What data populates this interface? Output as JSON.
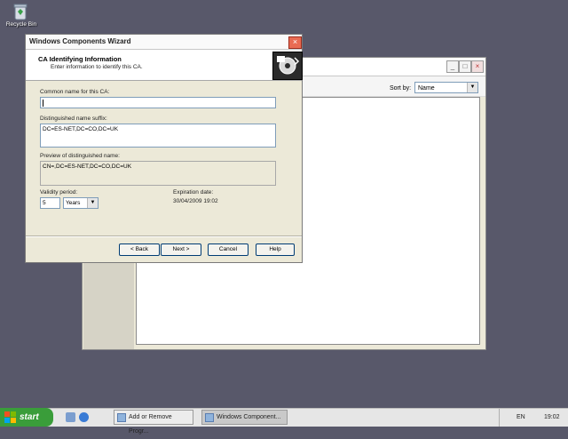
{
  "desktop": {
    "recycle_bin_label": "Recycle Bin"
  },
  "background_window": {
    "sort_by_label": "Sort by:",
    "sort_by_value": "Name"
  },
  "wizard": {
    "title": "Windows Components Wizard",
    "heading": "CA Identifying Information",
    "subheading": "Enter information to identify this CA.",
    "common_name_label": "Common name for this CA:",
    "common_name_value": "",
    "dn_suffix_label": "Distinguished name suffix:",
    "dn_suffix_value": "DC=ES-NET,DC=CO,DC=UK",
    "preview_label": "Preview of distinguished name:",
    "preview_value": "CN=,DC=ES-NET,DC=CO,DC=UK",
    "validity_label": "Validity period:",
    "validity_value": "5",
    "validity_unit": "Years",
    "expiration_label": "Expiration date:",
    "expiration_value": "30/04/2009 19:02",
    "buttons": {
      "back": "< Back",
      "next": "Next >",
      "cancel": "Cancel",
      "help": "Help"
    }
  },
  "taskbar": {
    "start_label": "start",
    "tasks": [
      {
        "label": "Add or Remove Progr..."
      },
      {
        "label": "Windows Component..."
      }
    ],
    "language": "EN",
    "clock": "19:02"
  },
  "colors": {
    "desktop": "#58586a",
    "start_button": "#3a9d3a",
    "close_button": "#e96b53"
  }
}
